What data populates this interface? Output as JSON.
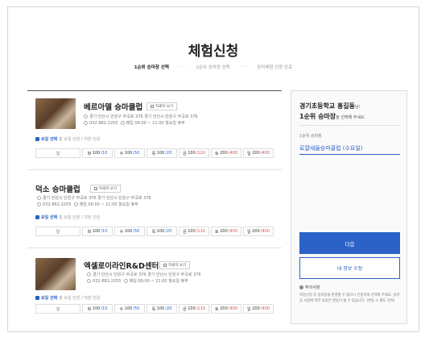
{
  "page_title": "체험신청",
  "steps": [
    {
      "label": "1순위 승마장 선택",
      "active": true
    },
    {
      "label": "2순위 승마장 선택",
      "active": false
    },
    {
      "label": "승마체험 신청 완료",
      "active": false
    }
  ],
  "cards": [
    {
      "name": "베르아델 승마클럽",
      "detail_label": "자세히 보기",
      "address": "경기 안산시 단원구 부곡로 376 경기 안산시 단원구 부곡로 376",
      "phone": "032-882-2255",
      "hours": "매일 06:00 ~ 21:00 월요일 휴무",
      "day_title": "요일 선택",
      "day_sub": "총 요일 인원 / 지원 인원",
      "days": [
        {
          "label": "일",
          "count": "",
          "cap": ""
        },
        {
          "label": "화",
          "count": "100",
          "cap": "/10"
        },
        {
          "label": "수",
          "count": "100",
          "cap": "/50"
        },
        {
          "label": "목",
          "count": "100",
          "cap": "/20"
        },
        {
          "label": "금",
          "count": "100",
          "cap": "/110"
        },
        {
          "label": "토",
          "count": "200",
          "cap": "/400"
        },
        {
          "label": "일",
          "count": "200",
          "cap": "/400"
        }
      ]
    },
    {
      "name": "덕소 승마클럽",
      "detail_label": "자세히 보기",
      "address": "경기 안산시 단원구 부곡로 376 경기 안산시 단원구 부곡로 376",
      "phone": "032-882-2255",
      "hours": "매일 06:00 ~ 21:00 월요일 휴무",
      "day_title": "요일 선택",
      "day_sub": "총 요일 인원 / 지원 인원",
      "days": [
        {
          "label": "일",
          "count": "",
          "cap": ""
        },
        {
          "label": "화",
          "count": "100",
          "cap": "/10"
        },
        {
          "label": "수",
          "count": "100",
          "cap": "/50"
        },
        {
          "label": "목",
          "count": "100",
          "cap": "/20"
        },
        {
          "label": "금",
          "count": "100",
          "cap": "/110"
        },
        {
          "label": "토",
          "count": "200",
          "cap": "/400"
        },
        {
          "label": "일",
          "count": "200",
          "cap": "/400"
        }
      ]
    },
    {
      "name": "엑셀로이라인R&D센터",
      "detail_label": "자세히 보기",
      "address": "경기 안산시 단원구 부곡로 376 경기 안산시 단원구 부곡로 376",
      "phone": "032-882-2255",
      "hours": "매일 06:00 ~ 21:00 월요일 휴무",
      "day_title": "요일 선택",
      "day_sub": "총 요일 인원 / 지원 인원",
      "days": [
        {
          "label": "일",
          "count": "",
          "cap": ""
        },
        {
          "label": "화",
          "count": "100",
          "cap": "/10"
        },
        {
          "label": "수",
          "count": "100",
          "cap": "/50"
        },
        {
          "label": "목",
          "count": "100",
          "cap": "/20"
        },
        {
          "label": "금",
          "count": "100",
          "cap": "/110"
        },
        {
          "label": "토",
          "count": "200",
          "cap": "/400"
        },
        {
          "label": "일",
          "count": "200",
          "cap": "/400"
        }
      ]
    }
  ],
  "panel": {
    "greet_name": "경기초등학교 홍길동",
    "greet_name_suffix": "님!",
    "greet_line2": "1순위 승마장",
    "greet_line2_suffix": "을 선택해 주세요.",
    "selected_label": "1순위 승마장",
    "selected_value": "로얄새들승마클럽 (수요일)",
    "next_label": "다음",
    "edit_label": "내 정보 수정",
    "note_title": "주의사항",
    "note_body": "희망신청 후 승마장을 변경할 수 없으니 신중하게 선택해 주세요. 승마장 사정에 따라 요일은 변동이 될 수 있습니다. (변동 시 별도 연락)"
  },
  "colors": {
    "accent": "#2a62c7",
    "red": "#e05050"
  }
}
